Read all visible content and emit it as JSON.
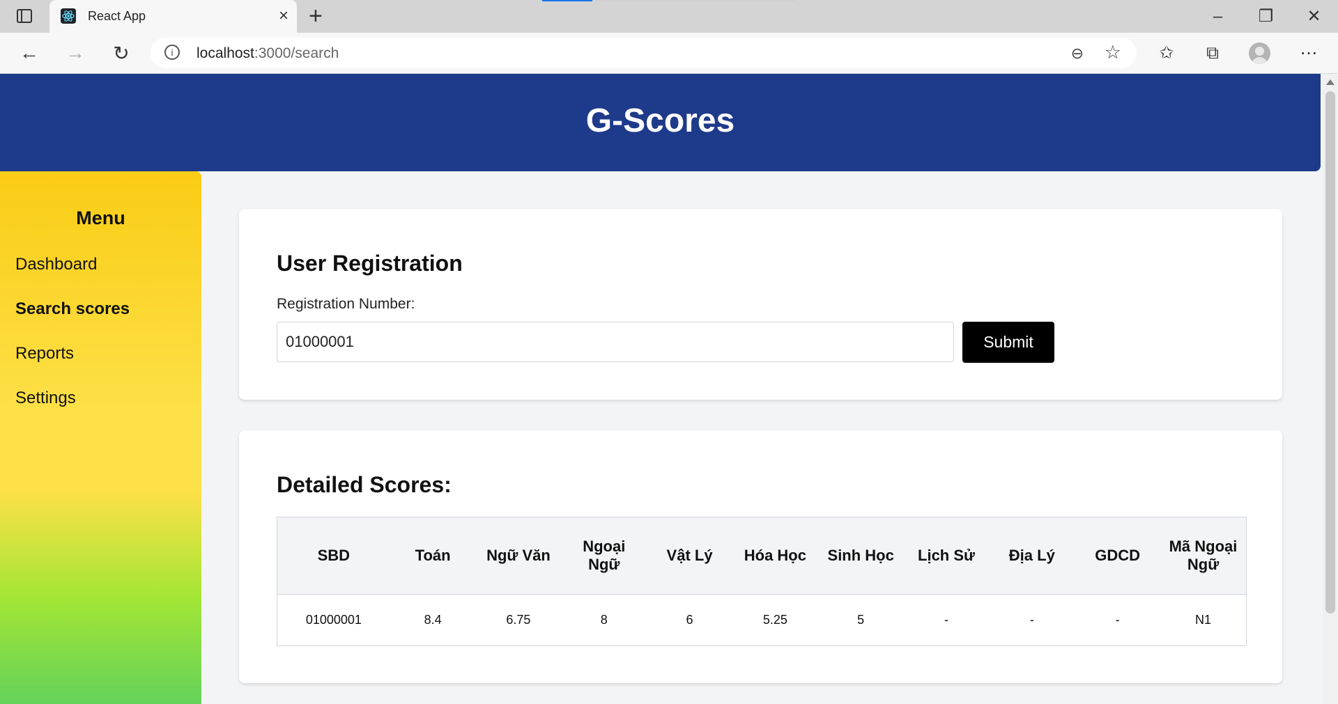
{
  "browser": {
    "tab_title": "React App",
    "url_host": "localhost",
    "url_path": ":3000/search",
    "icons": [
      "sidebar-tabs-icon",
      "react-icon",
      "close-icon",
      "plus-icon",
      "minimize-icon",
      "restore-icon",
      "close-window-icon",
      "back-icon",
      "forward-icon",
      "refresh-icon",
      "info-icon",
      "zoom-out-icon",
      "favorite-add-icon",
      "favorites-icon",
      "collections-icon",
      "profile-icon",
      "more-icon"
    ]
  },
  "site": {
    "title": "G-Scores"
  },
  "sidebar": {
    "title": "Menu",
    "items": [
      {
        "label": "Dashboard",
        "active": false
      },
      {
        "label": "Search scores",
        "active": true
      },
      {
        "label": "Reports",
        "active": false
      },
      {
        "label": "Settings",
        "active": false
      }
    ]
  },
  "registration": {
    "title": "User Registration",
    "label": "Registration Number:",
    "value": "01000001",
    "submit_label": "Submit"
  },
  "scores": {
    "title": "Detailed Scores:",
    "headers": [
      "SBD",
      "Toán",
      "Ngữ Văn",
      "Ngoại Ngữ",
      "Vật Lý",
      "Hóa Học",
      "Sinh Học",
      "Lịch Sử",
      "Địa Lý",
      "GDCD",
      "Mã Ngoại Ngữ"
    ],
    "rows": [
      [
        "01000001",
        "8.4",
        "6.75",
        "8",
        "6",
        "5.25",
        "5",
        "-",
        "-",
        "-",
        "N1"
      ]
    ]
  },
  "colors": {
    "header": "#1e3a8a",
    "submit": "#000000",
    "sidebar_top": "#facc15",
    "sidebar_bottom": "#65d25a"
  }
}
